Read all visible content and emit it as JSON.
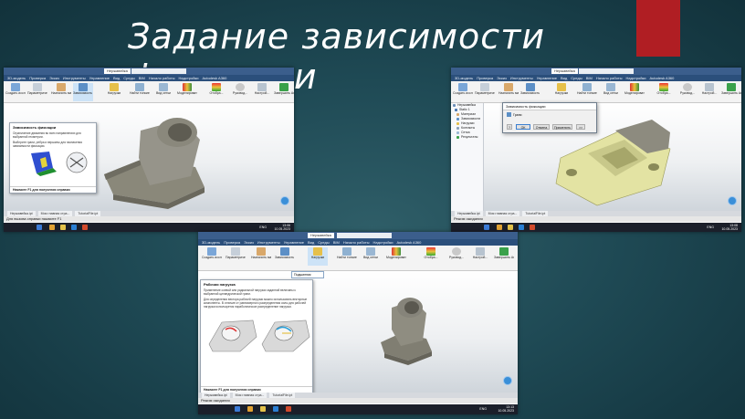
{
  "slide": {
    "title": "Задание зависимости фиксации"
  },
  "colors": {
    "accent_red": "#b01e23",
    "ribbon_blue": "#2b4f7b",
    "part_gray": "#8f8d7e",
    "part_yellow": "#e6e6a2"
  },
  "app": {
    "menu": [
      "3D-модель",
      "Проверка",
      "Эскиз",
      "Инструменты",
      "Управление",
      "Вид",
      "Среды",
      "BIM",
      "Начало работы",
      "Надстройки",
      "Autodesk A360"
    ],
    "doc_tab": "Нержавейка",
    "search_placeholder": "Поиск по справке и командам",
    "ribbon_buttons": [
      {
        "label": "Создать исследование",
        "icon": "study-icon"
      },
      {
        "label": "Параметрическая таблица",
        "icon": "table-icon"
      },
      {
        "label": "Назначить материал",
        "icon": "material-icon"
      },
      {
        "label": "Зависимость фиксации",
        "icon": "fix-constraint-icon"
      },
      {
        "label": "Нагрузки",
        "icon": "load-icon"
      },
      {
        "label": "Найти тонкие тела",
        "icon": "thin-body-icon"
      },
      {
        "label": "Вид сетки",
        "icon": "mesh-icon"
      },
      {
        "label": "Моделировать",
        "icon": "simulate-icon"
      },
      {
        "label": "Отобра...",
        "icon": "display-icon"
      },
      {
        "label": "Руковод...",
        "icon": "guide-icon"
      },
      {
        "label": "Настрой...",
        "icon": "settings-icon"
      },
      {
        "label": "Завершить Анализ",
        "icon": "finish-icon"
      }
    ],
    "doc_tabs": [
      "Нержавейка.ipt",
      "Моя главная стра...",
      "TutorialFile.ipt"
    ]
  },
  "shot1": {
    "tooltip_title": "Зависимость фиксации",
    "tooltip_text1": "Ограничение движения во всех направлениях для выбранной геометрии.",
    "tooltip_text2": "Выберите грани, ребра и вершины для назначения зависимости фиксации.",
    "tooltip_foot": "Нажмите F1 для получения справки",
    "status": "Для вызова справки нажмите F1",
    "clock_time": "13:06",
    "clock_date": "10.05.2023",
    "lang": "ENG"
  },
  "shot2": {
    "browser_items": [
      "Нержавейка",
      "Static 1",
      "Материал",
      "Зависимости",
      "Нагрузки",
      "Контакты",
      "Сетка",
      "Результаты"
    ],
    "dialog_title": "Зависимость фиксации",
    "dialog_field": "Грани",
    "btn_ok": "ОК",
    "btn_cancel": "Отмена",
    "btn_apply": "Применить",
    "status": "Режим ожидания",
    "clock_time": "13:08",
    "clock_date": "10.05.2023",
    "lang": "ENG"
  },
  "shot3": {
    "dropdown_item": "Подшипник",
    "tooltip_title": "Рабочая нагрузка",
    "tooltip_text1": "Применение осевой или радиальной нагрузки заданной величины к выбранной цилиндрической грани.",
    "tooltip_text2": "Для определения вектора рабочей нагрузки можно использовать векторные компоненты. В отличие от равномерного распределения силы для рабочей нагрузки используется параболическое распределение нагрузки.",
    "tooltip_foot": "Нажмите F1 для получения справки",
    "status": "Режим ожидания",
    "clock_time": "13:13",
    "clock_date": "10.05.2023",
    "lang": "ENG"
  }
}
